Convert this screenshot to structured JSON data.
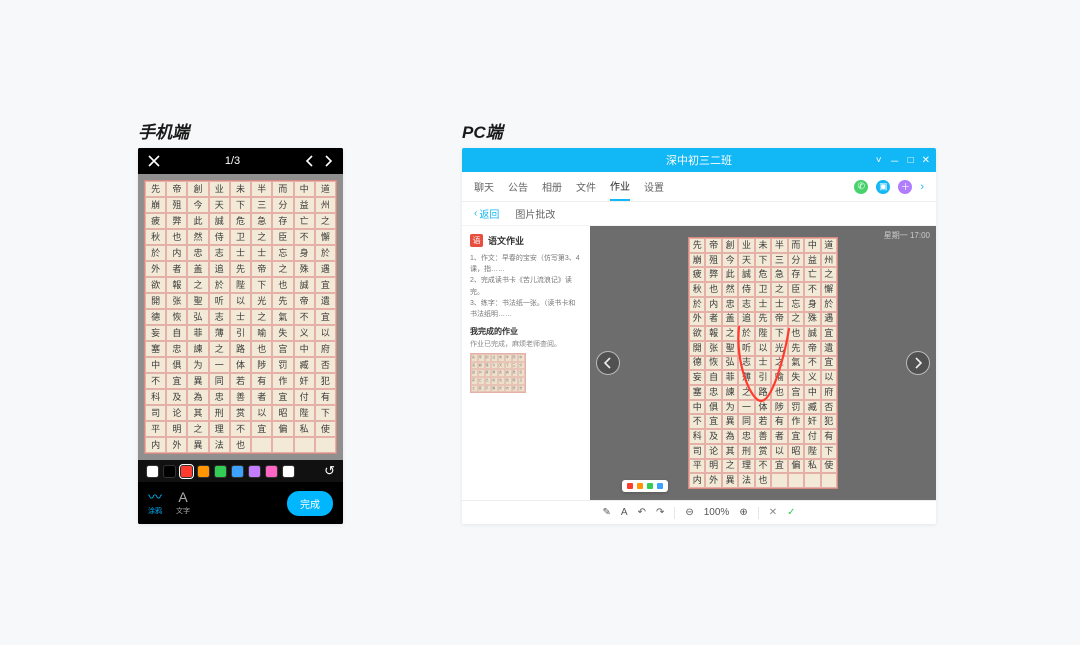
{
  "labels": {
    "mobile": "手机端",
    "pc": "PC端"
  },
  "mobile": {
    "counter": "1/3",
    "colors": [
      "#ffffff",
      "#000000",
      "#ff3b30",
      "#ff9500",
      "#33cc55",
      "#3da1ff",
      "#c47dff",
      "#ff66c4",
      "#ffffff"
    ],
    "color_active_index": 2,
    "undo_glyph": "↺",
    "tools": {
      "brush": "涂鸦",
      "text": "文字"
    },
    "done": "完成"
  },
  "calligraphy": {
    "chars": [
      "先",
      "帝",
      "創",
      "业",
      "未",
      "半",
      "而",
      "中",
      "道",
      "崩",
      "殂",
      "今",
      "天",
      "下",
      "三",
      "分",
      "益",
      "州",
      "疲",
      "弊",
      "此",
      "誠",
      "危",
      "急",
      "存",
      "亡",
      "之",
      "秋",
      "也",
      "然",
      "侍",
      "卫",
      "之",
      "臣",
      "不",
      "懈",
      "於",
      "内",
      "忠",
      "志",
      "士",
      "士",
      "忘",
      "身",
      "於",
      "外",
      "者",
      "盖",
      "追",
      "先",
      "帝",
      "之",
      "殊",
      "遇",
      "欲",
      "報",
      "之",
      "於",
      "陛",
      "下",
      "也",
      "誠",
      "宜",
      "開",
      "张",
      "聖",
      "听",
      "以",
      "光",
      "先",
      "帝",
      "遺",
      "德",
      "恢",
      "弘",
      "志",
      "士",
      "之",
      "氣",
      "不",
      "宜",
      "妄",
      "自",
      "菲",
      "薄",
      "引",
      "喻",
      "失",
      "义",
      "以",
      "塞",
      "忠",
      "諫",
      "之",
      "路",
      "也",
      "宫",
      "中",
      "府",
      "中",
      "俱",
      "为",
      "一",
      "体",
      "陟",
      "罚",
      "臧",
      "否",
      "不",
      "宜",
      "異",
      "同",
      "若",
      "有",
      "作",
      "奸",
      "犯",
      "科",
      "及",
      "為",
      "忠",
      "善",
      "者",
      "宜",
      "付",
      "有",
      "司",
      "论",
      "其",
      "刑",
      "赏",
      "以",
      "昭",
      "陛",
      "下",
      "平",
      "明",
      "之",
      "理",
      "不",
      "宜",
      "偏",
      "私",
      "使",
      "内",
      "外",
      "異",
      "法",
      "也"
    ]
  },
  "pc": {
    "title": "深中初三二班",
    "tabs": [
      "聊天",
      "公告",
      "相册",
      "文件",
      "作业",
      "设置"
    ],
    "tab_active_index": 4,
    "subnav": {
      "back": "返回",
      "item": "图片批改"
    },
    "side": {
      "badge": "语",
      "title": "语文作业",
      "lines": [
        "1、作文：早春的宝安（仿写第3、4课，指……",
        "2、完成读书卡《苦儿流浪记》读完。",
        "3、练字：书法纸一张。（读书卡和书法纸明……"
      ],
      "heading": "我完成的作业",
      "sub": "作业已完成，麻烦老师查阅。"
    },
    "meta": "星期一  17:00",
    "palette": [
      "#ff3b30",
      "#ff9500",
      "#33cc55",
      "#3da1ff"
    ],
    "toolbar": {
      "zoom": "100%",
      "pencil": "✎",
      "text": "A",
      "undo": "↶",
      "redo": "↷",
      "zin": "⊕",
      "zout": "⊖",
      "close": "✕",
      "check": "✓"
    }
  }
}
